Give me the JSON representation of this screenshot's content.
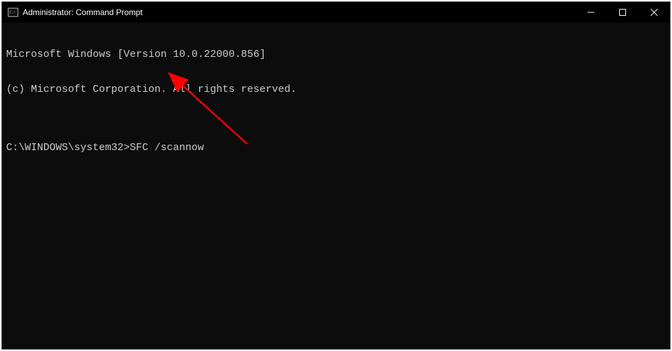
{
  "window": {
    "title": "Administrator: Command Prompt"
  },
  "terminal": {
    "line1": "Microsoft Windows [Version 10.0.22000.856]",
    "line2": "(c) Microsoft Corporation. All rights reserved.",
    "blank": "",
    "prompt": "C:\\WINDOWS\\system32>",
    "command": "SFC /scannow"
  }
}
